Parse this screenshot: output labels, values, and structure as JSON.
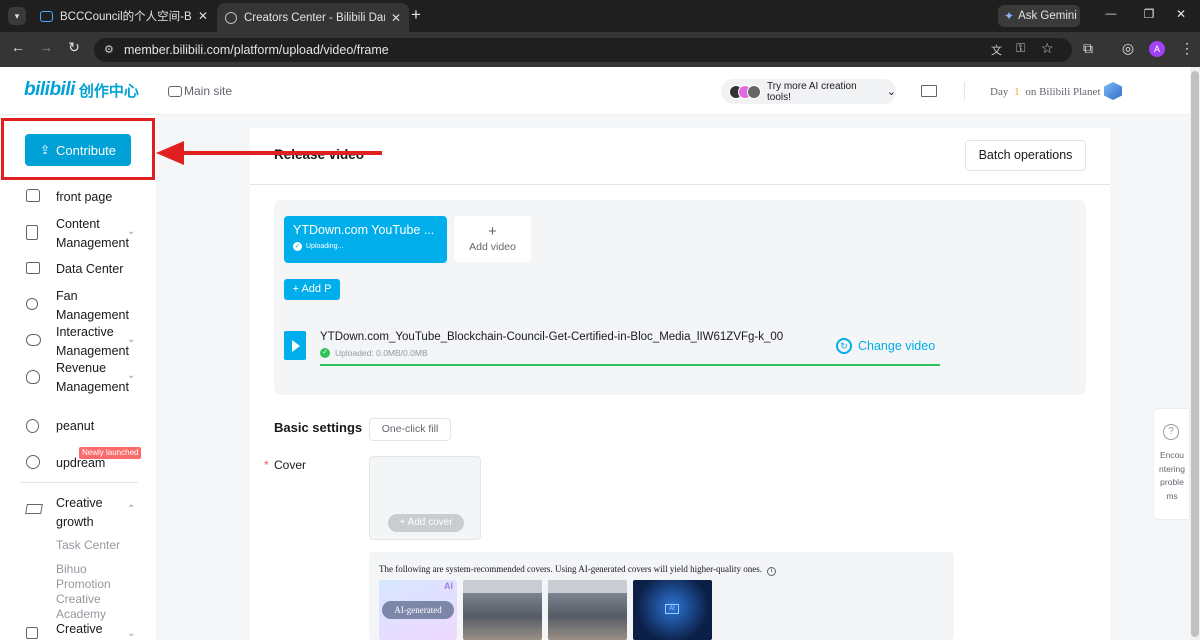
{
  "browser": {
    "tabs": [
      {
        "title": "BCCCouncil的个人空间-BCCCou",
        "active": false
      },
      {
        "title": "Creators Center - Bilibili Danma",
        "active": true
      }
    ],
    "new_tab": "+",
    "ask_gemini": "Ask Gemini",
    "url": "member.bilibili.com/platform/upload/video/frame",
    "profile_initial": "A",
    "window_controls": [
      "—",
      "❐",
      "✕"
    ]
  },
  "header": {
    "logo_text": "bilibili",
    "logo_cn": "创作中心",
    "main_site": "Main site",
    "ai_tools": "Try more AI creation tools!",
    "planet_prefix": "Day",
    "planet_day": "1",
    "planet_suffix": "on Bilibili Planet"
  },
  "sidebar": {
    "contribute": "Contribute",
    "items": [
      {
        "label": "front page",
        "icon": "home-icon"
      },
      {
        "label": "Content Management",
        "icon": "document-icon",
        "chevron": true
      },
      {
        "label": "Data Center",
        "icon": "chart-icon"
      },
      {
        "label": "Fan Management",
        "icon": "user-icon"
      },
      {
        "label": "Interactive Management",
        "icon": "chat-icon",
        "chevron": true
      },
      {
        "label": "Revenue Management",
        "icon": "revenue-icon",
        "chevron": true
      },
      {
        "label": "peanut",
        "icon": "peanut-icon"
      },
      {
        "label": "updream",
        "icon": "updream-icon",
        "badge": "Newly launched"
      },
      {
        "label": "Creative growth",
        "icon": "graduation-cap-icon",
        "chevron": true
      }
    ],
    "sub_items": [
      "Task Center",
      "Bihuo Promotion",
      "Creative Academy",
      "Creative"
    ]
  },
  "main": {
    "title": "Release video",
    "batch": "Batch operations",
    "upload_card_title": "YTDown.com YouTube ...",
    "upload_card_status": "Uploading...",
    "add_video_plus": "+",
    "add_video": "Add video",
    "add_p": "+ Add P",
    "file_name": "YTDown.com_YouTube_Blockchain-Council-Get-Certified-in-Bloc_Media_lIW61ZVFg-k_00",
    "uploaded": "Uploaded: 0.0MB/0.0MB",
    "upload_progress": 1.0,
    "change_video": "Change video",
    "basic_settings": "Basic settings",
    "one_click_fill": "One-click fill",
    "cover_required": "*",
    "cover_label": "Cover",
    "add_cover": "+ Add cover",
    "recommend_text": "The following are system-recommended covers. Using AI-generated covers will yield higher-quality ones.",
    "ai_badge": "AI",
    "ai_generated": "AI-generated",
    "help_text": "Encountering problems"
  },
  "colors": {
    "accent": "#00a1d6",
    "annotation_red": "#e02020",
    "progress_green": "#2fc35b",
    "badge_red": "#fb6b6b"
  }
}
